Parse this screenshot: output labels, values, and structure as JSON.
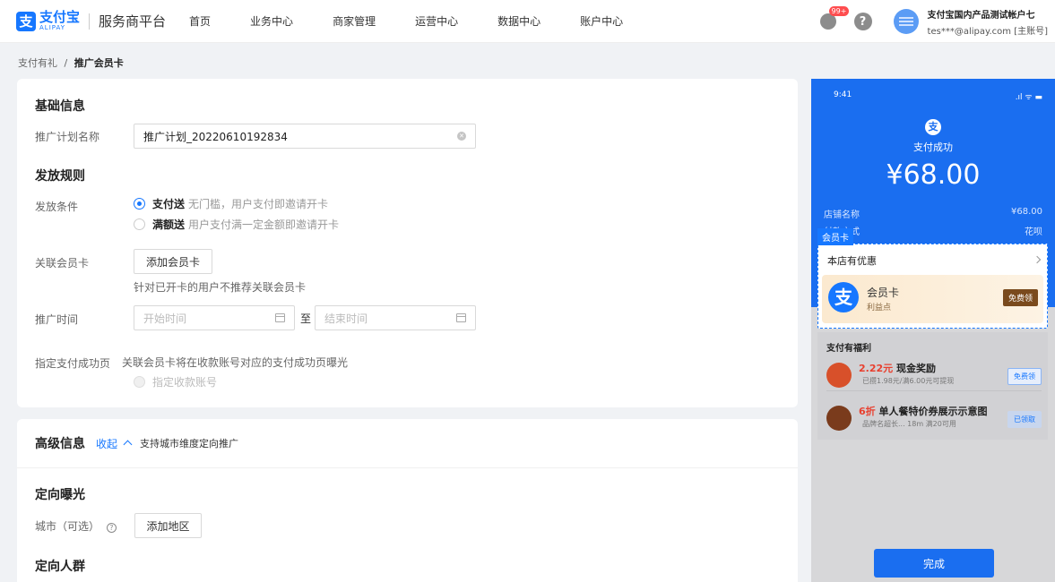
{
  "header": {
    "logo_cn": "支付宝",
    "logo_en": "ALIPAY",
    "logo_mark": "支",
    "platform": "服务商平台",
    "nav": [
      "首页",
      "业务中心",
      "商家管理",
      "运营中心",
      "数据中心",
      "账户中心"
    ],
    "badge": "99+",
    "help": "?",
    "user_name": "支付宝国内产品测试帐户七",
    "user_email": "tes***@alipay.com [主账号]"
  },
  "breadcrumb": {
    "parent": "支付有礼",
    "sep": "/",
    "current": "推广会员卡"
  },
  "basic": {
    "title": "基础信息",
    "plan_label": "推广计划名称",
    "plan_value": "推广计划_20220610192834"
  },
  "rules": {
    "title": "发放规则",
    "condition_label": "发放条件",
    "option1_strong": "支付送",
    "option1_desc": "无门槛，用户支付即邀请开卡",
    "option2_strong": "满额送",
    "option2_desc": "用户支付满一定金额即邀请开卡",
    "member_label": "关联会员卡",
    "add_member_btn": "添加会员卡",
    "member_hint": "针对已开卡的用户不推荐关联会员卡",
    "time_label": "推广时间",
    "start_placeholder": "开始时间",
    "to": "至",
    "end_placeholder": "结束时间",
    "page_label": "指定支付成功页",
    "page_desc": "关联会员卡将在收款账号对应的支付成功页曝光",
    "page_option": "指定收款账号"
  },
  "advanced": {
    "title": "高级信息",
    "collapse": "收起",
    "subtitle": "支持城市维度定向推广",
    "exposure_title": "定向曝光",
    "city_label": "城市（可选）",
    "add_region_btn": "添加地区",
    "crowd_title": "定向人群"
  },
  "preview": {
    "time": "9:41",
    "status_icons": ".ıl ᯤ ▬",
    "pay_icon": "支",
    "pay_success": "支付成功",
    "amount": "¥68.00",
    "shop_label": "店铺名称",
    "shop_value": "¥68.00",
    "method_label": "付款方式",
    "method_value": "花呗",
    "member_tag": "会员卡",
    "shop_offer": "本店有优惠",
    "card_logo": "支",
    "card_title": "会员卡",
    "card_sub": "利益点",
    "card_btn": "免费领",
    "welfare_title": "支付有福利",
    "w1_num": "2.22元",
    "w1_text": "现金奖励",
    "w1_sub": "已攒1.98元/满6.00元可提现",
    "w1_btn": "免费领",
    "w2_num": "6折",
    "w2_text": "单人餐特价券展示示意图",
    "w2_sub": "品牌名超长... 18m  满20可用",
    "w2_btn": "已领取",
    "finish": "完成"
  },
  "colors": {
    "accent": "#1677ff",
    "preview_blue": "#1a6ef0",
    "red": "#e8402f"
  }
}
